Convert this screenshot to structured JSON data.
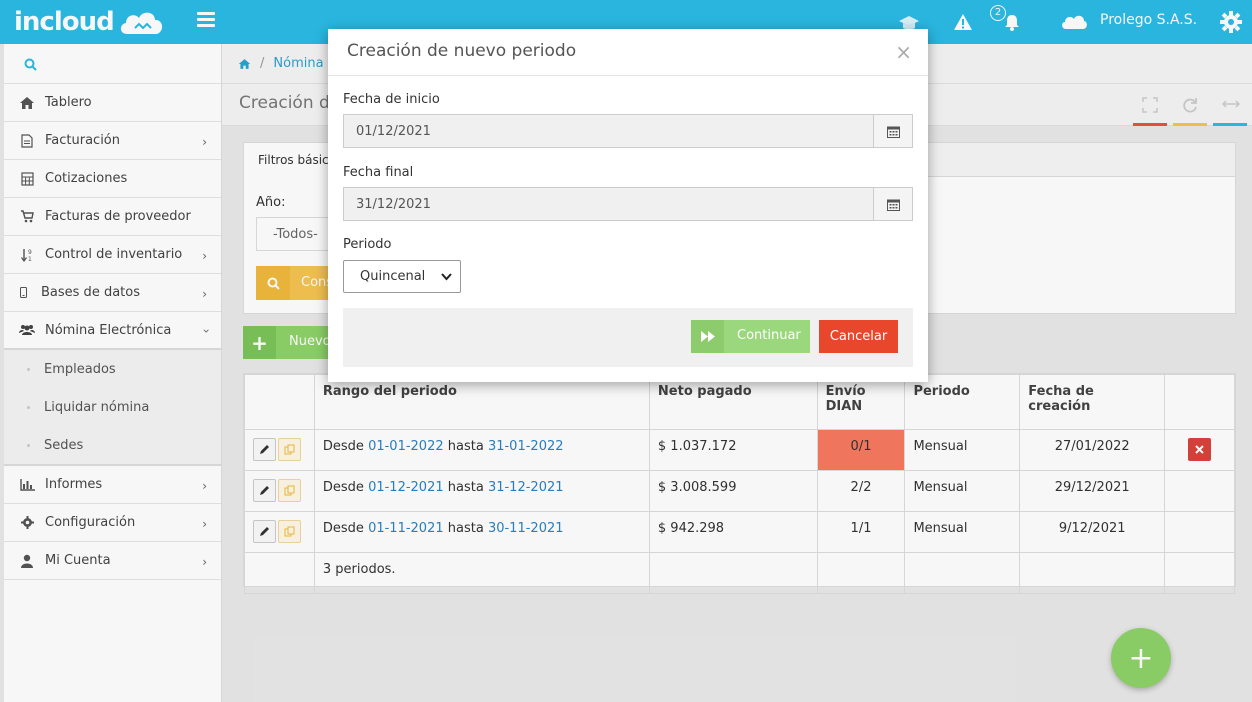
{
  "brand": {
    "logo_text": "incloud",
    "company": "Prolego S.A.S.",
    "notification_count": "2"
  },
  "colors": {
    "topbar": "#2bbbe6",
    "success": "#8ed36a",
    "danger": "#e8472b",
    "warning": "#f6c453",
    "link": "#2a82c4"
  },
  "sidebar": {
    "items": [
      {
        "label": "Tablero",
        "icon": "home-icon"
      },
      {
        "label": "Facturación",
        "icon": "document-icon"
      },
      {
        "label": "Cotizaciones",
        "icon": "calculator-icon"
      },
      {
        "label": "Facturas de proveedor",
        "icon": "cart-icon"
      },
      {
        "label": "Control de inventario",
        "icon": "sort-icon"
      },
      {
        "label": "Bases de datos",
        "icon": "mobile-icon"
      },
      {
        "label": "Nómina Electrónica",
        "icon": "users-icon"
      }
    ],
    "sub_items": [
      "Empleados",
      "Liquidar nómina",
      "Sedes"
    ],
    "bottom_items": [
      {
        "label": "Informes",
        "icon": "bar-chart-icon"
      },
      {
        "label": "Configuración",
        "icon": "gear-icon"
      },
      {
        "label": "Mi Cuenta",
        "icon": "user-icon"
      }
    ]
  },
  "breadcrumb": {
    "current": "Nómina E"
  },
  "page": {
    "title": "Creación de"
  },
  "filters": {
    "tab_label": "Filtros básic",
    "anio_label": "Año:",
    "anio_value": "-Todos-",
    "consult_label": "Cons"
  },
  "new_button": {
    "label": "Nuevo"
  },
  "table": {
    "headers": [
      "Rango del periodo",
      "Neto pagado",
      "Envío DIAN",
      "Periodo",
      "Fecha de creación"
    ],
    "rows": [
      {
        "desde": "Desde",
        "start": "01-01-2022",
        "hasta": "hasta",
        "end": "31-01-2022",
        "neto": "$ 1.037.172",
        "dian": "0/1",
        "periodo": "Mensual",
        "creacion": "27/01/2022"
      },
      {
        "desde": "Desde",
        "start": "01-12-2021",
        "hasta": "hasta",
        "end": "31-12-2021",
        "neto": "$ 3.008.599",
        "dian": "2/2",
        "periodo": "Mensual",
        "creacion": "29/12/2021"
      },
      {
        "desde": "Desde",
        "start": "01-11-2021",
        "hasta": "hasta",
        "end": "30-11-2021",
        "neto": "$ 942.298",
        "dian": "1/1",
        "periodo": "Mensual",
        "creacion": "9/12/2021"
      }
    ],
    "footer": "3 periodos."
  },
  "modal": {
    "title": "Creación de nuevo periodo",
    "close": "×",
    "fecha_inicio_label": "Fecha de inicio",
    "fecha_inicio_value": "01/12/2021",
    "fecha_final_label": "Fecha final",
    "fecha_final_value": "31/12/2021",
    "periodo_label": "Periodo",
    "periodo_value": "Quincenal",
    "continuar_label": "Continuar",
    "cancelar_label": "Cancelar"
  }
}
